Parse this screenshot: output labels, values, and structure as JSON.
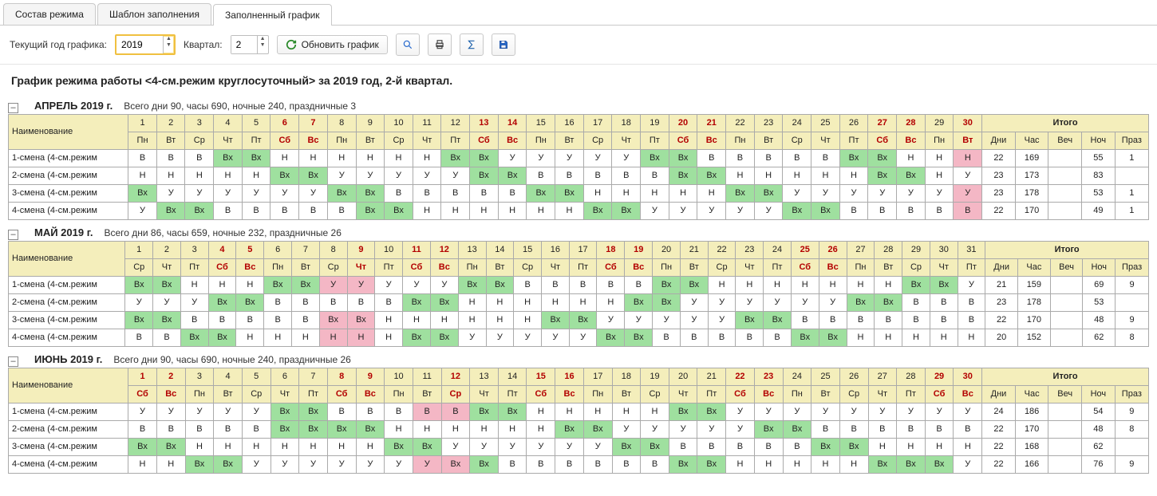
{
  "tabs": [
    "Состав режима",
    "Шаблон заполнения",
    "Заполненный график"
  ],
  "activeTab": 2,
  "toolbar": {
    "year_label": "Текущий год графика:",
    "year_value": "2019",
    "quarter_label": "Квартал:",
    "quarter_value": "2",
    "refresh": "Обновить график"
  },
  "title": "График режима работы <4-см.режим круглосуточный> за 2019 год, 2-й квартал.",
  "label_name": "Наименование",
  "label_total": "Итого",
  "total_cols": [
    "Дни",
    "Час",
    "Веч",
    "Ноч",
    "Праз"
  ],
  "months": [
    {
      "label": "АПРЕЛЬ 2019 г.",
      "summary": "Всего дни 90, часы 690, ночные 240, праздничные 3",
      "nums": [
        "1",
        "2",
        "3",
        "4",
        "5",
        "6",
        "7",
        "8",
        "9",
        "10",
        "11",
        "12",
        "13",
        "14",
        "15",
        "16",
        "17",
        "18",
        "19",
        "20",
        "21",
        "22",
        "23",
        "24",
        "25",
        "26",
        "27",
        "28",
        "29",
        "30"
      ],
      "numsRed": [
        0,
        0,
        0,
        0,
        0,
        1,
        1,
        0,
        0,
        0,
        0,
        0,
        1,
        1,
        0,
        0,
        0,
        0,
        0,
        1,
        1,
        0,
        0,
        0,
        0,
        0,
        1,
        1,
        0,
        1
      ],
      "dows": [
        "Пн",
        "Вт",
        "Ср",
        "Чт",
        "Пт",
        "Сб",
        "Вс",
        "Пн",
        "Вт",
        "Ср",
        "Чт",
        "Пт",
        "Сб",
        "Вс",
        "Пн",
        "Вт",
        "Ср",
        "Чт",
        "Пт",
        "Сб",
        "Вс",
        "Пн",
        "Вт",
        "Ср",
        "Чт",
        "Пт",
        "Сб",
        "Вс",
        "Пн",
        "Вт"
      ],
      "rows": [
        {
          "name": "1-смена (4-см.режим",
          "cells": [
            "В",
            "В",
            "В",
            "Вх",
            "Вх",
            "Н",
            "Н",
            "Н",
            "Н",
            "Н",
            "Н",
            "Вх",
            "Вх",
            "У",
            "У",
            "У",
            "У",
            "У",
            "Вх",
            "Вх",
            "В",
            "В",
            "В",
            "В",
            "В",
            "Вх",
            "Вх",
            "Н"
          ],
          "tail": [
            {
              "v": "Н",
              "c": ""
            }
          ],
          "last": {
            "v": "Н",
            "c": "h"
          },
          "tot": [
            "22",
            "169",
            "",
            "55",
            "1"
          ]
        },
        {
          "name": "2-смена (4-см.режим",
          "cells": [
            "Н",
            "Н",
            "Н",
            "Н",
            "Н",
            "Вх",
            "Вх",
            "У",
            "У",
            "У",
            "У",
            "У",
            "Вх",
            "Вх",
            "В",
            "В",
            "В",
            "В",
            "В",
            "Вх",
            "Вх",
            "Н",
            "Н",
            "Н",
            "Н",
            "Н",
            "Вх",
            "Вх"
          ],
          "tail": [
            {
              "v": "Н",
              "c": ""
            }
          ],
          "last": {
            "v": "У",
            "c": ""
          },
          "tot": [
            "23",
            "173",
            "",
            "83",
            ""
          ]
        },
        {
          "name": "3-смена (4-см.режим",
          "cells": [
            "Вх",
            "У",
            "У",
            "У",
            "У",
            "У",
            "У",
            "Вх",
            "Вх",
            "В",
            "В",
            "В",
            "В",
            "В",
            "Вх",
            "Вх",
            "Н",
            "Н",
            "Н",
            "Н",
            "Н",
            "Вх",
            "Вх",
            "У",
            "У",
            "У",
            "У",
            "У"
          ],
          "tail": [
            {
              "v": "У",
              "c": ""
            }
          ],
          "last": {
            "v": "У",
            "c": "h"
          },
          "tot": [
            "23",
            "178",
            "",
            "53",
            "1"
          ]
        },
        {
          "name": "4-смена (4-см.режим",
          "cells": [
            "У",
            "Вх",
            "Вх",
            "В",
            "В",
            "В",
            "В",
            "В",
            "Вх",
            "Вх",
            "Н",
            "Н",
            "Н",
            "Н",
            "Н",
            "Н",
            "Вх",
            "Вх",
            "У",
            "У",
            "У",
            "У",
            "У",
            "Вх",
            "Вх",
            "В",
            "В",
            "В"
          ],
          "tail": [
            {
              "v": "В",
              "c": ""
            }
          ],
          "last": {
            "v": "В",
            "c": "h"
          },
          "tot": [
            "22",
            "170",
            "",
            "49",
            "1"
          ]
        }
      ]
    },
    {
      "label": "МАЙ 2019 г.",
      "summary": "Всего дни 86, часы 659, ночные 232, праздничные 26",
      "nums": [
        "1",
        "2",
        "3",
        "4",
        "5",
        "6",
        "7",
        "8",
        "9",
        "10",
        "11",
        "12",
        "13",
        "14",
        "15",
        "16",
        "17",
        "18",
        "19",
        "20",
        "21",
        "22",
        "23",
        "24",
        "25",
        "26",
        "27",
        "28",
        "29",
        "30",
        "31"
      ],
      "numsRed": [
        0,
        0,
        0,
        1,
        1,
        0,
        0,
        0,
        1,
        0,
        1,
        1,
        0,
        0,
        0,
        0,
        0,
        1,
        1,
        0,
        0,
        0,
        0,
        0,
        1,
        1,
        0,
        0,
        0,
        0,
        0
      ],
      "dows": [
        "Ср",
        "Чт",
        "Пт",
        "Сб",
        "Вс",
        "Пн",
        "Вт",
        "Ср",
        "Чт",
        "Пт",
        "Сб",
        "Вс",
        "Пн",
        "Вт",
        "Ср",
        "Чт",
        "Пт",
        "Сб",
        "Вс",
        "Пн",
        "Вт",
        "Ср",
        "Чт",
        "Пт",
        "Сб",
        "Вс",
        "Пн",
        "Вт",
        "Ср",
        "Чт",
        "Пт"
      ],
      "rows": [
        {
          "name": "1-смена (4-см.режим",
          "cells": [
            "Вх",
            "Вх",
            "Н",
            "Н",
            "Н",
            "Вх",
            "Вх",
            "У",
            "У",
            "У",
            "У",
            "У",
            "Вх",
            "Вх",
            "В",
            "В",
            "В",
            "В",
            "В",
            "Вх",
            "Вх",
            "Н",
            "Н",
            "Н",
            "Н",
            "Н",
            "Н",
            "Н"
          ],
          "tail": [
            {
              "v": "Вх",
              "c": "vx"
            },
            {
              "v": "Вх",
              "c": "vx"
            }
          ],
          "last": {
            "v": "У",
            "c": ""
          },
          "tot": [
            "21",
            "159",
            "",
            "69",
            "9"
          ],
          "holIdx": [
            8,
            9
          ]
        },
        {
          "name": "2-смена (4-см.режим",
          "cells": [
            "У",
            "У",
            "У",
            "Вх",
            "Вх",
            "В",
            "В",
            "В",
            "В",
            "В",
            "Вх",
            "Вх",
            "Н",
            "Н",
            "Н",
            "Н",
            "Н",
            "Н",
            "Вх",
            "Вх",
            "У",
            "У",
            "У",
            "У",
            "У",
            "У",
            "Вх",
            "Вх"
          ],
          "tail": [
            {
              "v": "В",
              "c": ""
            },
            {
              "v": "В",
              "c": ""
            }
          ],
          "last": {
            "v": "В",
            "c": ""
          },
          "tot": [
            "23",
            "178",
            "",
            "53",
            ""
          ]
        },
        {
          "name": "3-смена (4-см.режим",
          "cells": [
            "Вх",
            "Вх",
            "В",
            "В",
            "В",
            "В",
            "В",
            "Вх",
            "Вх",
            "Н",
            "Н",
            "Н",
            "Н",
            "Н",
            "Н",
            "Вх",
            "Вх",
            "У",
            "У",
            "У",
            "У",
            "У",
            "Вх",
            "Вх",
            "В",
            "В",
            "В",
            "В"
          ],
          "tail": [
            {
              "v": "В",
              "c": ""
            },
            {
              "v": "В",
              "c": ""
            }
          ],
          "last": {
            "v": "В",
            "c": ""
          },
          "tot": [
            "22",
            "170",
            "",
            "48",
            "9"
          ],
          "holIdx": [
            8,
            9
          ]
        },
        {
          "name": "4-смена (4-см.режим",
          "cells": [
            "В",
            "В",
            "Вх",
            "Вх",
            "Н",
            "Н",
            "Н",
            "Н",
            "Н",
            "Н",
            "Вх",
            "Вх",
            "У",
            "У",
            "У",
            "У",
            "У",
            "Вх",
            "Вх",
            "В",
            "В",
            "В",
            "В",
            "В",
            "Вх",
            "Вх",
            "Н",
            "Н"
          ],
          "tail": [
            {
              "v": "Н",
              "c": ""
            },
            {
              "v": "Н",
              "c": ""
            }
          ],
          "last": {
            "v": "Н",
            "c": ""
          },
          "tot": [
            "20",
            "152",
            "",
            "62",
            "8"
          ],
          "holIdx": [
            8,
            9
          ]
        }
      ]
    },
    {
      "label": "ИЮНЬ 2019 г.",
      "summary": "Всего дни 90, часы 690, ночные 240, праздничные 26",
      "nums": [
        "1",
        "2",
        "3",
        "4",
        "5",
        "6",
        "7",
        "8",
        "9",
        "10",
        "11",
        "12",
        "13",
        "14",
        "15",
        "16",
        "17",
        "18",
        "19",
        "20",
        "21",
        "22",
        "23",
        "24",
        "25",
        "26",
        "27",
        "28",
        "29",
        "30"
      ],
      "numsRed": [
        1,
        1,
        0,
        0,
        0,
        0,
        0,
        1,
        1,
        0,
        0,
        1,
        0,
        0,
        1,
        1,
        0,
        0,
        0,
        0,
        0,
        1,
        1,
        0,
        0,
        0,
        0,
        0,
        1,
        1
      ],
      "dows": [
        "Сб",
        "Вс",
        "Пн",
        "Вт",
        "Ср",
        "Чт",
        "Пт",
        "Сб",
        "Вс",
        "Пн",
        "Вт",
        "Ср",
        "Чт",
        "Пт",
        "Сб",
        "Вс",
        "Пн",
        "Вт",
        "Ср",
        "Чт",
        "Пт",
        "Сб",
        "Вс",
        "Пн",
        "Вт",
        "Ср",
        "Чт",
        "Пт",
        "Сб",
        "Вс"
      ],
      "rows": [
        {
          "name": "1-смена (4-см.режим",
          "cells": [
            "У",
            "У",
            "У",
            "У",
            "У",
            "Вх",
            "Вх",
            "В",
            "В",
            "В",
            "В",
            "В",
            "Вх",
            "Вх",
            "Н",
            "Н",
            "Н",
            "Н",
            "Н",
            "Вх",
            "Вх",
            "У",
            "У",
            "У",
            "У",
            "У",
            "У",
            "У"
          ],
          "tail": [
            {
              "v": "У",
              "c": ""
            }
          ],
          "last": {
            "v": "У",
            "c": ""
          },
          "tot": [
            "24",
            "186",
            "",
            "54",
            "9"
          ],
          "holIdx": [
            11,
            12
          ]
        },
        {
          "name": "2-смена (4-см.режим",
          "cells": [
            "В",
            "В",
            "В",
            "В",
            "В",
            "Вх",
            "Вх",
            "Вх",
            "Вх",
            "Н",
            "Н",
            "Н",
            "Н",
            "Н",
            "Н",
            "Вх",
            "Вх",
            "У",
            "У",
            "У",
            "У",
            "У",
            "Вх",
            "Вх",
            "В",
            "В",
            "В",
            "В"
          ],
          "tail": [
            {
              "v": "В",
              "c": ""
            }
          ],
          "last": {
            "v": "В",
            "c": ""
          },
          "tot": [
            "22",
            "170",
            "",
            "48",
            "8"
          ]
        },
        {
          "name": "3-смена (4-см.режим",
          "cells": [
            "Вх",
            "Вх",
            "Н",
            "Н",
            "Н",
            "Н",
            "Н",
            "Н",
            "Н",
            "Вх",
            "Вх",
            "У",
            "У",
            "У",
            "У",
            "У",
            "У",
            "Вх",
            "Вх",
            "В",
            "В",
            "В",
            "В",
            "В",
            "Вх",
            "Вх",
            "Н",
            "Н"
          ],
          "tail": [
            {
              "v": "Н",
              "c": ""
            }
          ],
          "last": {
            "v": "Н",
            "c": ""
          },
          "tot": [
            "22",
            "168",
            "",
            "62",
            ""
          ]
        },
        {
          "name": "4-смена (4-см.режим",
          "cells": [
            "Н",
            "Н",
            "Вх",
            "Вх",
            "У",
            "У",
            "У",
            "У",
            "У",
            "У",
            "У",
            "Вх",
            "Вх",
            "В",
            "В",
            "В",
            "В",
            "В",
            "В",
            "Вх",
            "Вх",
            "Н",
            "Н",
            "Н",
            "Н",
            "Н",
            "Вх",
            "Вх"
          ],
          "tail": [
            {
              "v": "Вх",
              "c": "vx"
            }
          ],
          "last": {
            "v": "У",
            "c": ""
          },
          "tot": [
            "22",
            "166",
            "",
            "76",
            "9"
          ],
          "holIdx": [
            11,
            12
          ]
        }
      ]
    }
  ]
}
